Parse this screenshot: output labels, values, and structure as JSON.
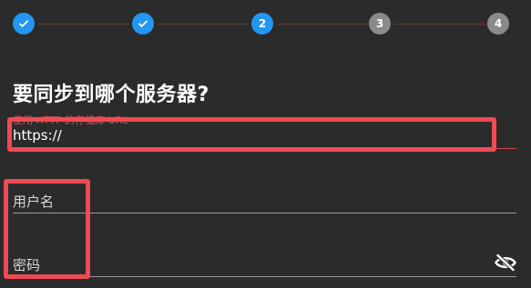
{
  "stepper": {
    "steps": [
      {
        "state": "done",
        "icon": "check-icon"
      },
      {
        "state": "done",
        "icon": "check-icon"
      },
      {
        "state": "active",
        "label": "2"
      },
      {
        "state": "pending",
        "label": "3"
      },
      {
        "state": "pending",
        "label": "4"
      }
    ]
  },
  "form": {
    "title": "要同步到哪个服务器?",
    "url": {
      "hint": "使用 HTTP 的存储库 URL",
      "value": "https://"
    },
    "username": {
      "label": "用户名"
    },
    "password": {
      "label": "密码",
      "toggle_icon": "eye-off-icon"
    }
  },
  "colors": {
    "background": "#2b2b2b",
    "accent": "#2196f3",
    "pending": "#8a8a8a",
    "error": "#e05050",
    "annotation": "#f04a55"
  }
}
